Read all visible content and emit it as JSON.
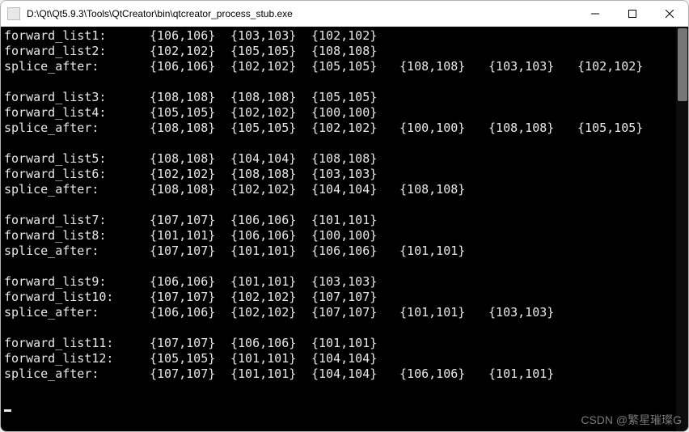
{
  "window": {
    "title": "D:\\Qt\\Qt5.9.3\\Tools\\QtCreator\\bin\\qtcreator_process_stub.exe"
  },
  "blocks": [
    {
      "lines": [
        {
          "label": "forward_list1:",
          "pairs": [
            "{106,106}",
            "{103,103}",
            "{102,102}"
          ]
        },
        {
          "label": "forward_list2:",
          "pairs": [
            "{102,102}",
            "{105,105}",
            "{108,108}"
          ]
        },
        {
          "label": "splice_after:",
          "pairs": [
            "{106,106}",
            "{102,102}",
            "{105,105}",
            "{108,108}",
            "{103,103}",
            "{102,102}"
          ]
        }
      ]
    },
    {
      "lines": [
        {
          "label": "forward_list3:",
          "pairs": [
            "{108,108}",
            "{108,108}",
            "{105,105}"
          ]
        },
        {
          "label": "forward_list4:",
          "pairs": [
            "{105,105}",
            "{102,102}",
            "{100,100}"
          ]
        },
        {
          "label": "splice_after:",
          "pairs": [
            "{108,108}",
            "{105,105}",
            "{102,102}",
            "{100,100}",
            "{108,108}",
            "{105,105}"
          ]
        }
      ]
    },
    {
      "lines": [
        {
          "label": "forward_list5:",
          "pairs": [
            "{108,108}",
            "{104,104}",
            "{108,108}"
          ]
        },
        {
          "label": "forward_list6:",
          "pairs": [
            "{102,102}",
            "{108,108}",
            "{103,103}"
          ]
        },
        {
          "label": "splice_after:",
          "pairs": [
            "{108,108}",
            "{102,102}",
            "{104,104}",
            "{108,108}"
          ]
        }
      ]
    },
    {
      "lines": [
        {
          "label": "forward_list7:",
          "pairs": [
            "{107,107}",
            "{106,106}",
            "{101,101}"
          ]
        },
        {
          "label": "forward_list8:",
          "pairs": [
            "{101,101}",
            "{106,106}",
            "{100,100}"
          ]
        },
        {
          "label": "splice_after:",
          "pairs": [
            "{107,107}",
            "{101,101}",
            "{106,106}",
            "{101,101}"
          ]
        }
      ]
    },
    {
      "lines": [
        {
          "label": "forward_list9:",
          "pairs": [
            "{106,106}",
            "{101,101}",
            "{103,103}"
          ]
        },
        {
          "label": "forward_list10:",
          "pairs": [
            "{107,107}",
            "{102,102}",
            "{107,107}"
          ]
        },
        {
          "label": "splice_after:",
          "pairs": [
            "{106,106}",
            "{102,102}",
            "{107,107}",
            "{101,101}",
            "{103,103}"
          ]
        }
      ]
    },
    {
      "lines": [
        {
          "label": "forward_list11:",
          "pairs": [
            "{107,107}",
            "{106,106}",
            "{101,101}"
          ]
        },
        {
          "label": "forward_list12:",
          "pairs": [
            "{105,105}",
            "{101,101}",
            "{104,104}"
          ]
        },
        {
          "label": "splice_after:",
          "pairs": [
            "{107,107}",
            "{101,101}",
            "{104,104}",
            "{106,106}",
            "{101,101}"
          ]
        }
      ]
    }
  ],
  "watermark": "CSDN @繁星璀璨G"
}
